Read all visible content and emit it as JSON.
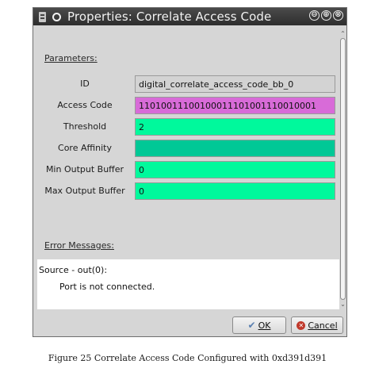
{
  "window": {
    "title": "Properties: Correlate Access Code",
    "buttons": [
      "⊖",
      "⊕",
      "⊗"
    ]
  },
  "parameters": {
    "section_title": "Parameters:",
    "rows": [
      {
        "label": "ID",
        "value": "digital_correlate_access_code_bb_0",
        "color": "#d3d3d3"
      },
      {
        "label": "Access Code",
        "value": "11010011100100011101001110010001",
        "color": "#d86bd8"
      },
      {
        "label": "Threshold",
        "value": "2",
        "color": "#00f99c"
      },
      {
        "label": "Core Affinity",
        "value": "",
        "color": "#00c896"
      },
      {
        "label": "Min Output Buffer",
        "value": "0",
        "color": "#00f99c"
      },
      {
        "label": "Max Output Buffer",
        "value": "0",
        "color": "#00f99c"
      }
    ]
  },
  "errors": {
    "section_title": "Error Messages:",
    "line1": "Source - out(0):",
    "line2": "Port is not connected."
  },
  "footer": {
    "ok_label": "OK",
    "ok_icon": "checkmark-icon",
    "cancel_label": "Cancel",
    "cancel_icon": "cancel-icon"
  },
  "caption": "Figure 25 Correlate Access Code Configured with 0xd391d391"
}
